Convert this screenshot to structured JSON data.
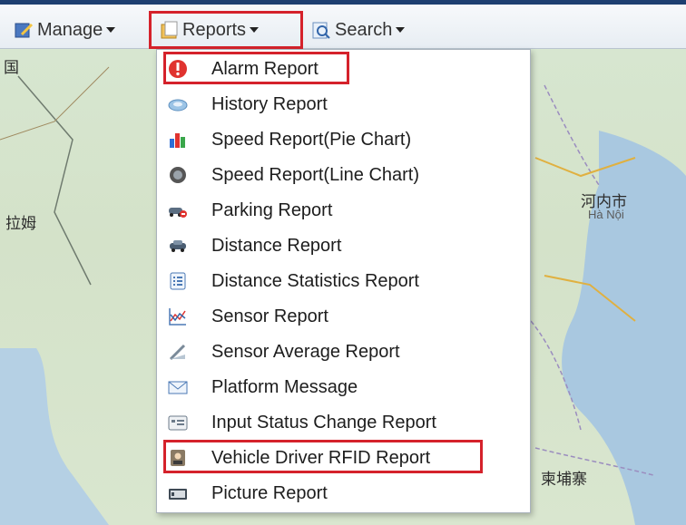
{
  "toolbar": {
    "manage_label": "Manage",
    "reports_label": "Reports",
    "search_label": "Search"
  },
  "reports_menu": [
    {
      "label": "Alarm Report",
      "icon": "alarm-icon"
    },
    {
      "label": "History Report",
      "icon": "history-icon"
    },
    {
      "label": "Speed Report(Pie Chart)",
      "icon": "bar-chart-icon"
    },
    {
      "label": "Speed Report(Line Chart)",
      "icon": "gauge-icon"
    },
    {
      "label": "Parking Report",
      "icon": "parking-car-icon"
    },
    {
      "label": "Distance Report",
      "icon": "car-icon"
    },
    {
      "label": "Distance Statistics Report",
      "icon": "list-icon"
    },
    {
      "label": "Sensor Report",
      "icon": "line-chart-icon"
    },
    {
      "label": "Sensor Average Report",
      "icon": "pen-icon"
    },
    {
      "label": "Platform Message",
      "icon": "envelope-icon"
    },
    {
      "label": "Input Status Change Report",
      "icon": "form-icon"
    },
    {
      "label": "Vehicle Driver RFID Report",
      "icon": "driver-icon"
    },
    {
      "label": "Picture Report",
      "icon": "camera-icon"
    }
  ],
  "map_labels": {
    "hanoi_cn": "河内市",
    "hanoi_vi": "Hà Nội",
    "cambodia": "柬埔寨",
    "left_label": "拉姆",
    "top_left": "国"
  },
  "colors": {
    "highlight": "#d5222b",
    "topbar_border": "#1e3f70"
  }
}
